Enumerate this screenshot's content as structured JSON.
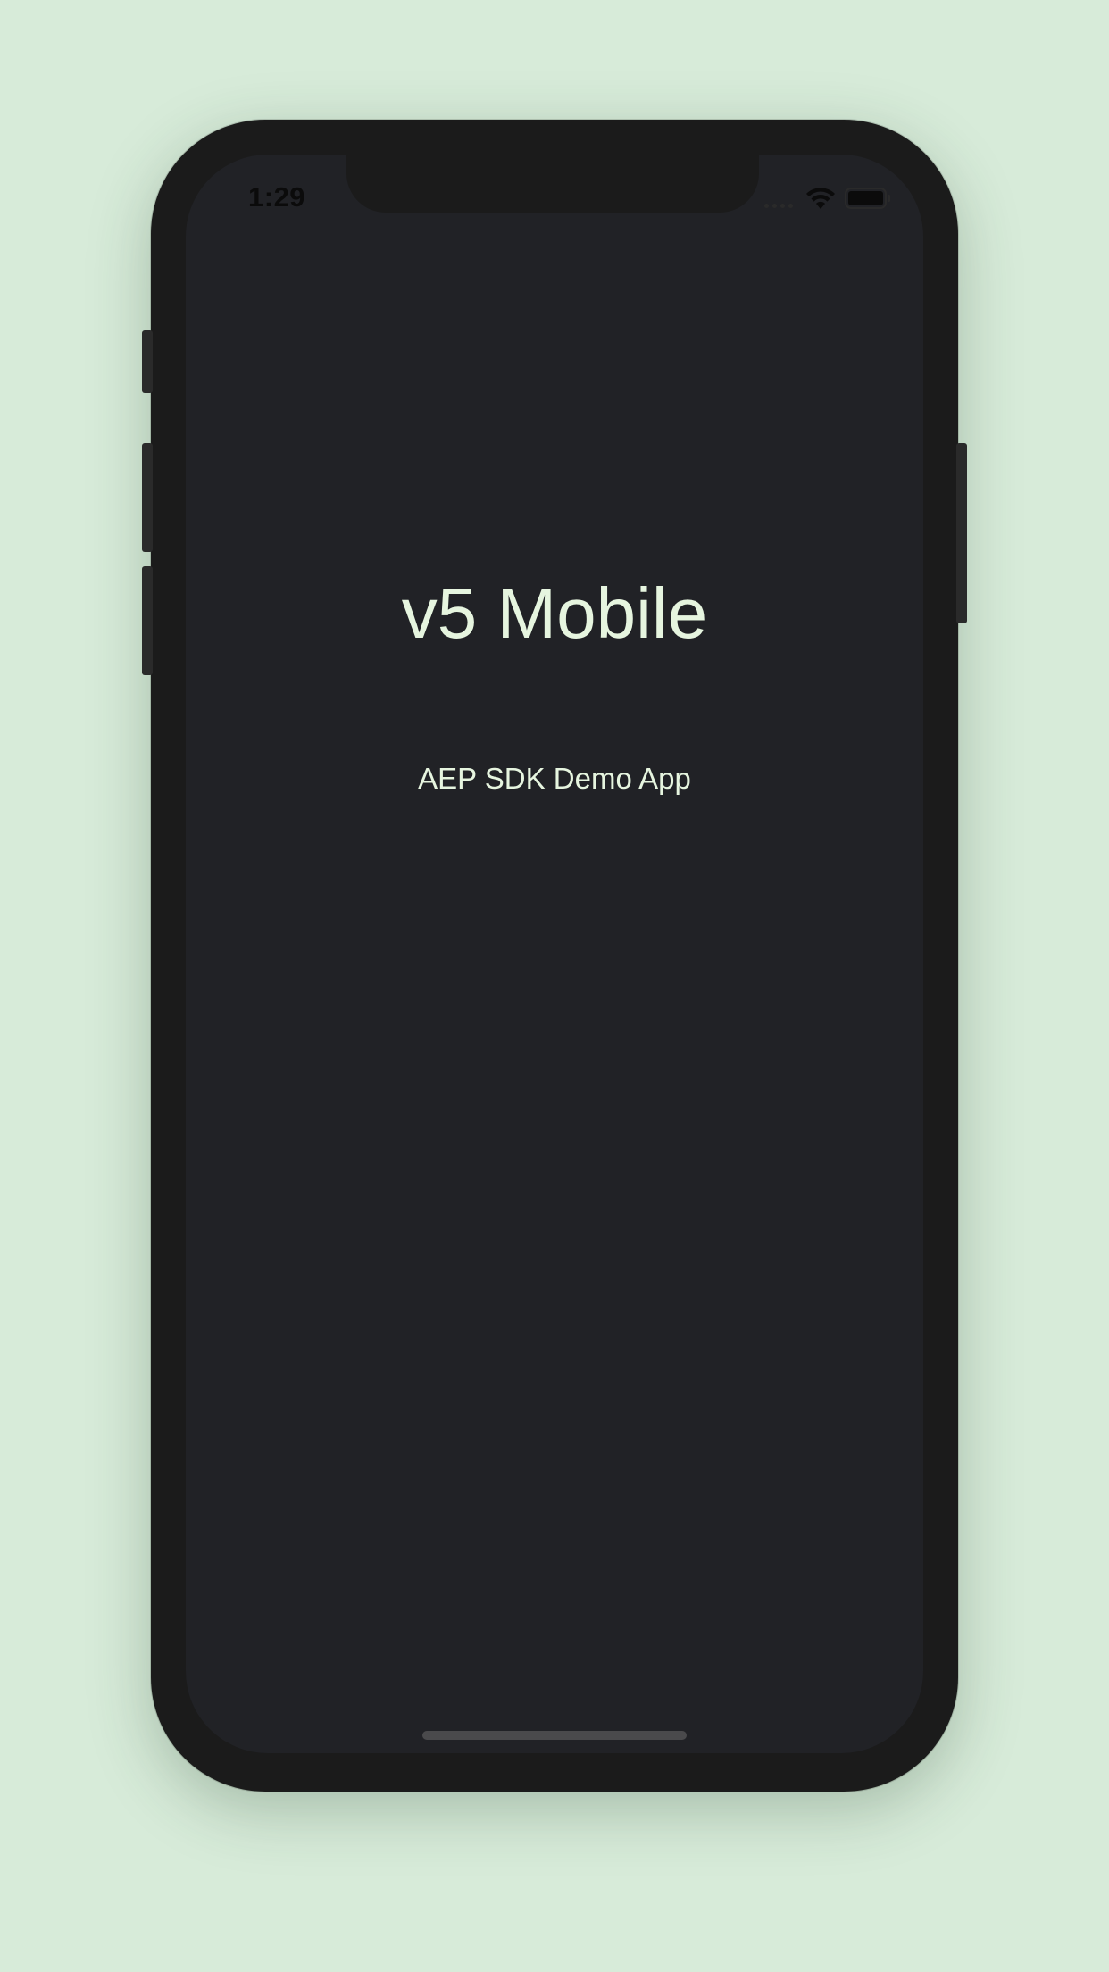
{
  "status_bar": {
    "time": "1:29",
    "icons": [
      "signal-icon",
      "wifi-icon",
      "battery-icon"
    ]
  },
  "main": {
    "title": "v5 Mobile",
    "subtitle": "AEP SDK Demo App"
  },
  "colors": {
    "page_background": "#d7ebd9",
    "device_frame": "#1b1b1b",
    "screen_background": "#212226",
    "text": "#e6f5df"
  }
}
